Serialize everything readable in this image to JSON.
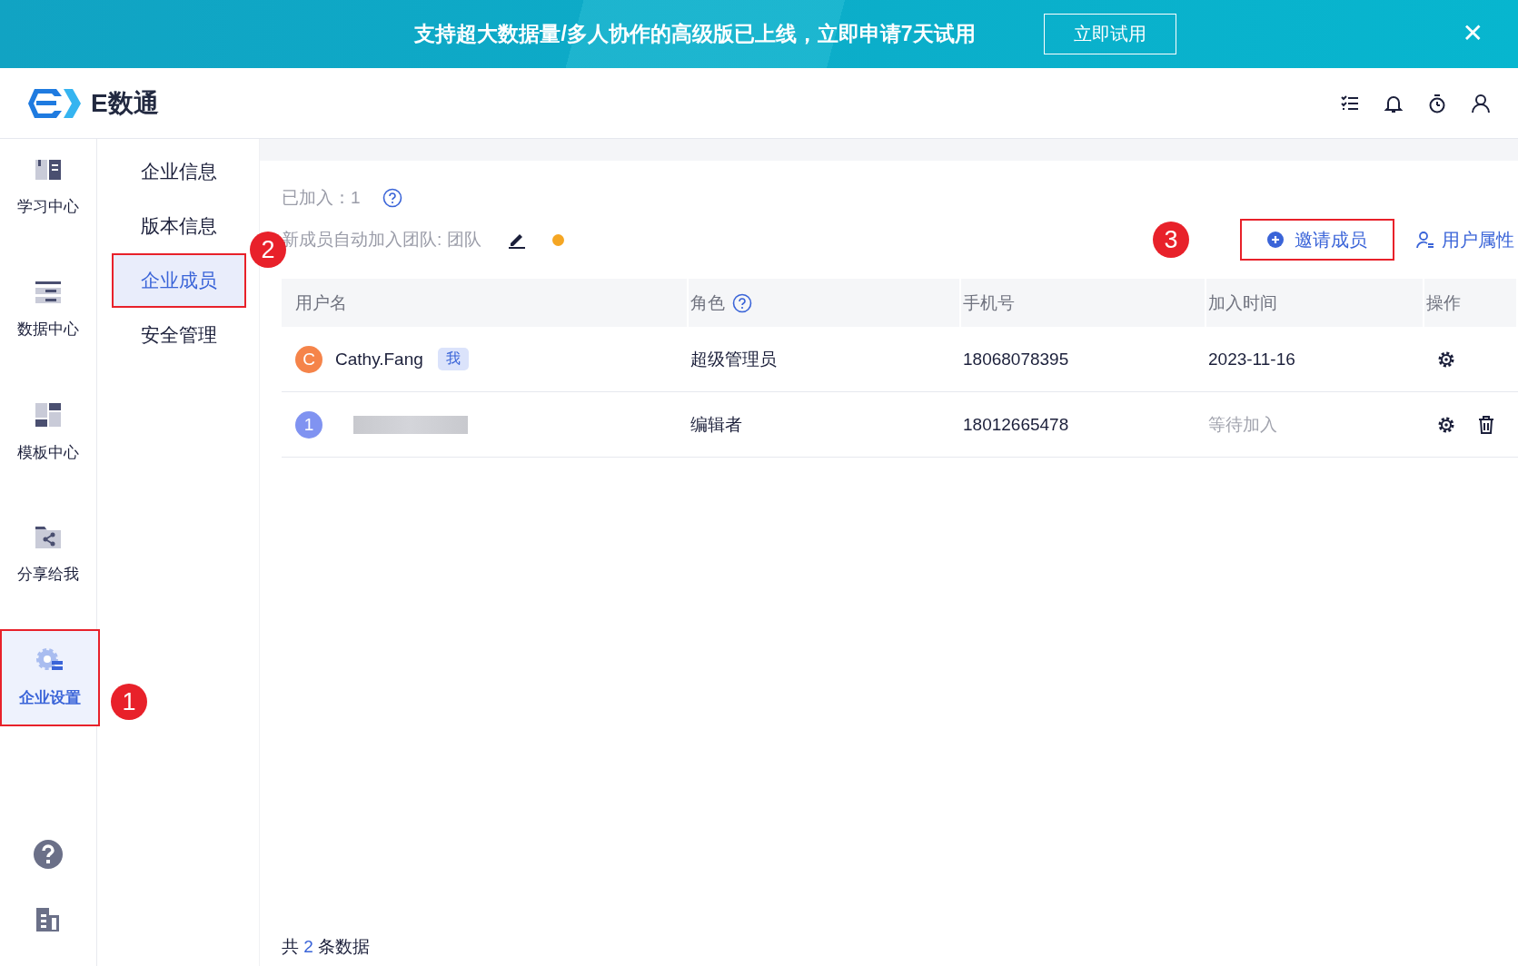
{
  "banner": {
    "text": "支持超大数据量/多人协作的高级版已上线，立即申请7天试用",
    "button": "立即试用",
    "close": "✕"
  },
  "header": {
    "logo_text": "E数通"
  },
  "nav": {
    "items": [
      {
        "label": "学习中心",
        "kind": "book",
        "selected": false
      },
      {
        "label": "数据中心",
        "kind": "data",
        "selected": false
      },
      {
        "label": "模板中心",
        "kind": "template",
        "selected": false
      },
      {
        "label": "分享给我",
        "kind": "share",
        "selected": false
      },
      {
        "label": "企业设置",
        "kind": "settings",
        "selected": true,
        "callout": "1"
      }
    ]
  },
  "submenu": {
    "items": [
      {
        "label": "企业信息",
        "selected": false
      },
      {
        "label": "版本信息",
        "selected": false
      },
      {
        "label": "企业成员",
        "selected": true,
        "callout": "2"
      },
      {
        "label": "安全管理",
        "selected": false
      }
    ]
  },
  "summary": {
    "joined_label": "已加入：",
    "joined_count": "1",
    "auto_join": "新成员自动加入团队: 团队"
  },
  "actions": {
    "invite": "邀请成员",
    "invite_callout": "3",
    "user_attributes": "用户属性"
  },
  "table": {
    "columns": [
      {
        "label": "用户名",
        "help": false
      },
      {
        "label": "角色",
        "help": true
      },
      {
        "label": "手机号",
        "help": false
      },
      {
        "label": "加入时间",
        "help": false
      },
      {
        "label": "操作",
        "help": false
      }
    ],
    "rows": [
      {
        "avatar": "C",
        "color": "#f5844a",
        "name": "Cathy.Fang",
        "name_blurred": false,
        "tag": "我",
        "role": "超级管理员",
        "phone": "18068078395",
        "joined": "2023-11-16",
        "pending": false,
        "actions": [
          {
            "kind": "settings"
          }
        ]
      },
      {
        "avatar": "1",
        "color": "#8093f1",
        "name_blurred": true,
        "role": "编辑者",
        "phone": "18012665478",
        "joined": "等待加入",
        "pending": true,
        "actions": [
          {
            "kind": "settings"
          },
          {
            "kind": "delete"
          }
        ]
      }
    ]
  },
  "footer": {
    "prefix": "共",
    "count": "2",
    "suffix": "条数据"
  }
}
